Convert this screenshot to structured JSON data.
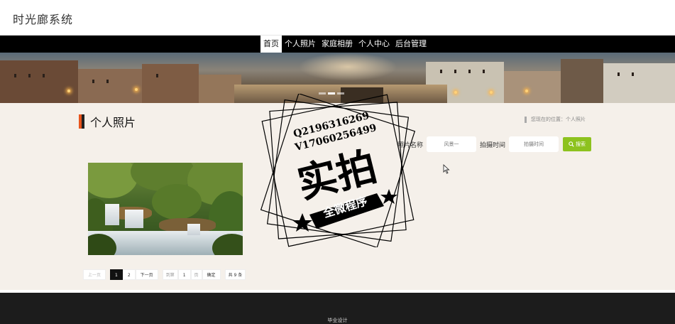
{
  "header": {
    "title": "时光廊系统"
  },
  "nav": {
    "items": [
      {
        "label": "首页",
        "active": true
      },
      {
        "label": "个人照片",
        "active": false
      },
      {
        "label": "家庭相册",
        "active": false
      },
      {
        "label": "个人中心",
        "active": false
      },
      {
        "label": "后台管理",
        "active": false
      }
    ]
  },
  "banner": {
    "slides": 3,
    "current_slide": 2
  },
  "section": {
    "title": "个人照片",
    "breadcrumb": "您现在的位置：个人照片"
  },
  "search": {
    "name_label": "照片名称",
    "name_placeholder": "风景一",
    "time_label": "拍摄时间",
    "time_placeholder": "拍摄时间",
    "button_label": "搜索"
  },
  "pager": {
    "prev": "上一页",
    "pages": [
      "1",
      "2"
    ],
    "current": "1",
    "next": "下一页",
    "goto": "到第",
    "goto_value": "1",
    "page_unit": "页",
    "confirm": "确定",
    "total": "共 9 条"
  },
  "watermark": {
    "line1": "Q2196316269",
    "line2": "V17060256499",
    "big": "实拍",
    "ribbon": "全微程序"
  },
  "footer": {
    "text": "毕业设计"
  },
  "colors": {
    "accent_green": "#8dc21f",
    "nav_bg": "#000000",
    "section_bar": "#e8541c",
    "footer_bg": "#1c1c1c"
  }
}
